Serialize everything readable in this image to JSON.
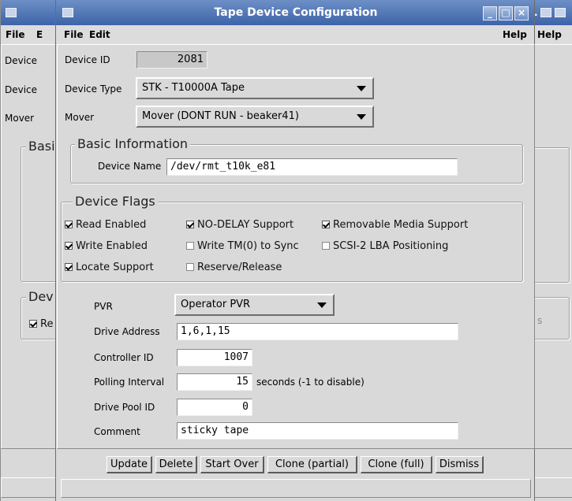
{
  "main": {
    "title": "Tape Device Configuration",
    "menu": {
      "file": "File",
      "edit": "Edit",
      "help": "Help"
    },
    "device_id": {
      "label": "Device ID",
      "value": "2081"
    },
    "device_type": {
      "label": "Device Type",
      "selected": "STK - T10000A Tape"
    },
    "mover": {
      "label": "Mover",
      "selected": "Mover (DONT RUN - beaker41)"
    },
    "basic_info": {
      "legend": "Basic Information",
      "device_name_label": "Device Name",
      "device_name_value": "/dev/rmt_t10k_e81"
    },
    "flags": {
      "legend": "Device Flags",
      "items": [
        {
          "label": "Read Enabled",
          "checked": true
        },
        {
          "label": "NO-DELAY Support",
          "checked": true
        },
        {
          "label": "Removable Media Support",
          "checked": true
        },
        {
          "label": "Write Enabled",
          "checked": true
        },
        {
          "label": "Write TM(0) to Sync",
          "checked": false
        },
        {
          "label": "SCSI-2 LBA Positioning",
          "checked": false
        },
        {
          "label": "Locate Support",
          "checked": true
        },
        {
          "label": "Reserve/Release",
          "checked": false
        }
      ]
    },
    "pvr": {
      "label": "PVR",
      "selected": "Operator PVR"
    },
    "drive_address": {
      "label": "Drive Address",
      "value": "1,6,1,15"
    },
    "controller_id": {
      "label": "Controller ID",
      "value": "1007"
    },
    "polling_interval": {
      "label": "Polling Interval",
      "value": "15",
      "suffix": "seconds (-1 to disable)"
    },
    "drive_pool_id": {
      "label": "Drive Pool ID",
      "value": "0"
    },
    "comment": {
      "label": "Comment",
      "value": "sticky tape"
    },
    "buttons": {
      "update": "Update",
      "delete": "Delete",
      "start_over": "Start Over",
      "clone_partial": "Clone (partial)",
      "clone_full": "Clone (full)",
      "dismiss": "Dismiss"
    }
  },
  "background_left": {
    "menu_file": "File",
    "menu_edit_fragment": "E",
    "row1": "Device",
    "row2": "Device",
    "row3": "Mover",
    "group1_fragment": "Basi",
    "group2_fragment": "Dev",
    "check_fragment": "Re"
  },
  "background_right": {
    "menu_help": "Help",
    "fragment_s": "s"
  },
  "colors": {
    "titlebar_top": "#6d8fc6",
    "titlebar_bottom": "#3d64a8",
    "window_bg": "#d9d9d9"
  }
}
